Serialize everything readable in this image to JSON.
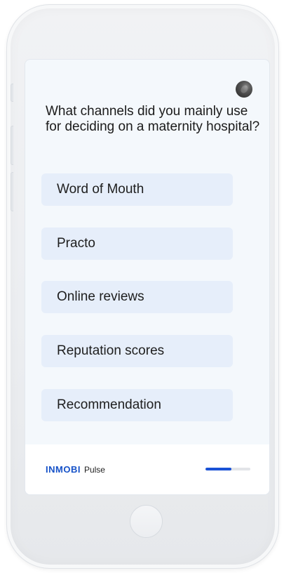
{
  "survey": {
    "question": "What channels did you mainly use for deciding on a maternity hospital?",
    "options": [
      {
        "label": "Word of Mouth"
      },
      {
        "label": "Practo"
      },
      {
        "label": "Online reviews"
      },
      {
        "label": "Reputation scores"
      },
      {
        "label": "Recommendation"
      }
    ]
  },
  "footer": {
    "brand_logo": "INMOBI",
    "brand_product": "Pulse",
    "progress_fraction": 0.58
  },
  "colors": {
    "accent": "#1a52d6",
    "option_bg": "#e6eefa",
    "screen_bg": "#f4f8fc"
  },
  "icons": {
    "close": "close-icon"
  }
}
